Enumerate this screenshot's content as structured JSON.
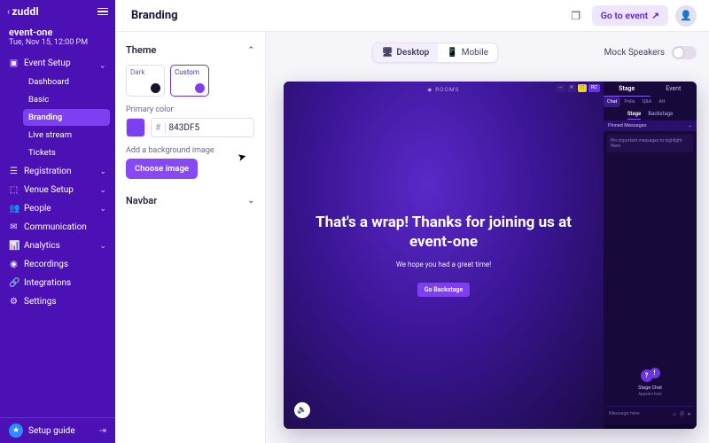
{
  "brand": "zuddl",
  "event": {
    "name": "event-one",
    "date": "Tue, Nov 15, 12:00 PM"
  },
  "sidebar": {
    "items": [
      {
        "label": "Event Setup",
        "icon": "▣",
        "expanded": true,
        "children": [
          {
            "label": "Dashboard"
          },
          {
            "label": "Basic"
          },
          {
            "label": "Branding",
            "active": true
          },
          {
            "label": "Live stream"
          },
          {
            "label": "Tickets"
          }
        ]
      },
      {
        "label": "Registration",
        "icon": "☰"
      },
      {
        "label": "Venue Setup",
        "icon": "⬚"
      },
      {
        "label": "People",
        "icon": "👥"
      },
      {
        "label": "Communication",
        "icon": "✉"
      },
      {
        "label": "Analytics",
        "icon": "📊"
      },
      {
        "label": "Recordings",
        "icon": "◉"
      },
      {
        "label": "Integrations",
        "icon": "🔗"
      },
      {
        "label": "Settings",
        "icon": "⚙"
      }
    ],
    "setup_guide": "Setup guide"
  },
  "topbar": {
    "title": "Branding",
    "go_to_event": "Go to event"
  },
  "panel": {
    "theme": {
      "title": "Theme",
      "dark": "Dark",
      "custom": "Custom",
      "primary_label": "Primary color",
      "primary_hex": "843DF5",
      "bg_label": "Add a background image",
      "choose": "Choose image"
    },
    "navbar": {
      "title": "Navbar"
    }
  },
  "preview": {
    "device": {
      "desktop": "Desktop",
      "mobile": "Mobile"
    },
    "mock_label": "Mock Speakers",
    "rooms": "ROOMS",
    "stage_tab": "Stage",
    "event_tab": "Event",
    "subtabs": {
      "chat": "Chat",
      "polls": "Polls",
      "qna": "Q&A",
      "att": "Att"
    },
    "stageback": {
      "stage": "Stage",
      "backstage": "Backstage"
    },
    "pinned": "Pinned Messages",
    "pin_hint": "Pin important messages to highlight them",
    "chat_icon": {
      "title": "Stage Chat",
      "sub": "Appears here"
    },
    "msg_placeholder": "Message here",
    "hero_title": "That's a wrap! Thanks for joining us at event-one",
    "hero_sub": "We hope you had a great time!",
    "backstage_btn": "Go Backstage",
    "pills": [
      "—",
      "✕",
      "⛶",
      "RC"
    ]
  }
}
